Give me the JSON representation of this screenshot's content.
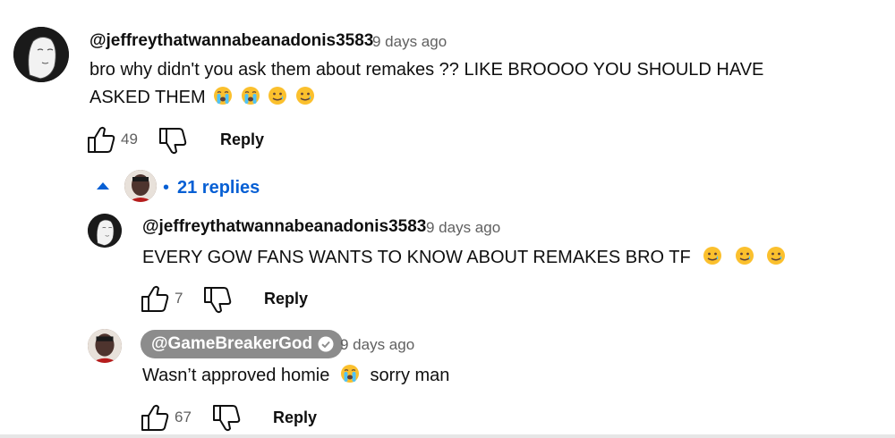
{
  "comments": [
    {
      "author": "@jeffreythatwannabeanadonis3583",
      "time": "9 days ago",
      "text_line1": "bro why didn't you ask them about remakes ?? LIKE BROOOO YOU SHOULD HAVE",
      "text_line2": "ASKED THEM",
      "likes": "49",
      "reply_label": "Reply",
      "emojis": [
        "crying-face-emoji",
        "crying-face-emoji",
        "smiling-face-with-tear-emoji",
        "smiling-face-with-tear-emoji"
      ]
    }
  ],
  "replies_toggle": {
    "label": "21 replies",
    "dot": "•"
  },
  "replies": [
    {
      "author": "@jeffreythatwannabeanadonis3583",
      "time": "9 days ago",
      "text": "EVERY GOW FANS WANTS TO KNOW ABOUT REMAKES BRO TF",
      "likes": "7",
      "reply_label": "Reply",
      "emojis": [
        "smiling-face-with-tear-emoji",
        "smiling-face-with-tear-emoji",
        "smiling-face-with-tear-emoji"
      ]
    },
    {
      "author": "@GameBreakerGod",
      "verified": true,
      "time": "9 days ago",
      "text_before": "Wasn’t approved homie",
      "text_after": "sorry man",
      "likes": "67",
      "reply_label": "Reply",
      "emojis": [
        "crying-face-emoji"
      ]
    }
  ],
  "colors": {
    "link_blue": "#065fd4",
    "meta_gray": "#606060",
    "owner_badge": "#8c8c8c",
    "emoji_yellow": "#fbc02d"
  }
}
